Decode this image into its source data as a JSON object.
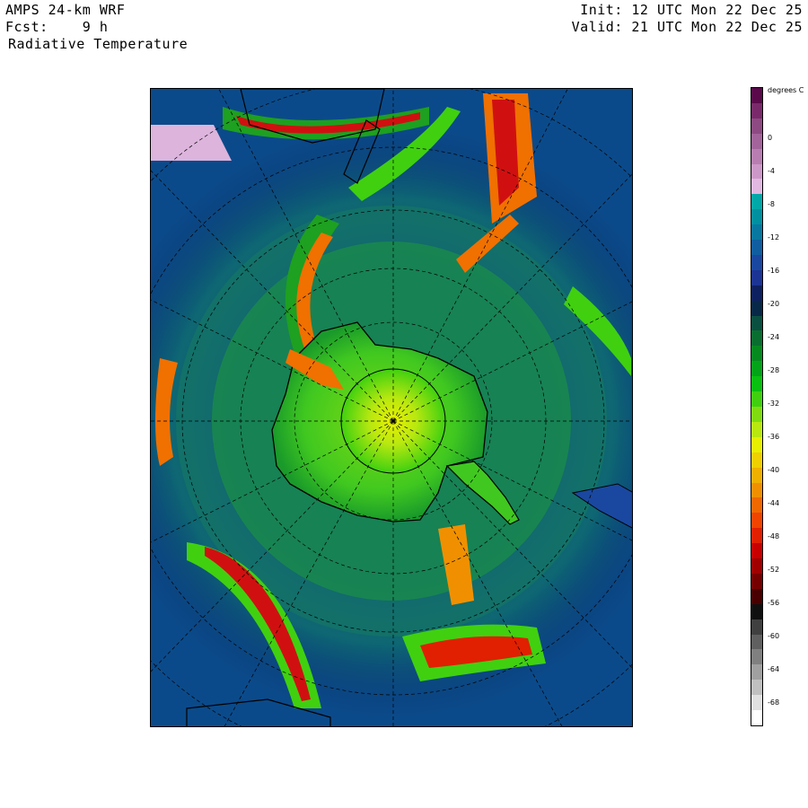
{
  "header": {
    "model": "AMPS 24-km WRF",
    "forecast": "Fcst:    9 h",
    "field": "Radiative Temperature",
    "init": "Init: 12 UTC Mon 22 Dec 25",
    "valid": "Valid: 21 UTC Mon 22 Dec 25"
  },
  "colorbar": {
    "units": "degrees C",
    "ticks": [
      "0",
      "-4",
      "-8",
      "-12",
      "-16",
      "-20",
      "-24",
      "-28",
      "-32",
      "-36",
      "-40",
      "-44",
      "-48",
      "-52",
      "-56",
      "-60",
      "-64",
      "-68"
    ],
    "colors": [
      "#5a0a4a",
      "#7a2a6a",
      "#8e4a82",
      "#a2649a",
      "#b87eb2",
      "#cc98c8",
      "#e0b8e0",
      "#00a8a8",
      "#0090a0",
      "#0878a0",
      "#105ea0",
      "#1a48a0",
      "#1c3494",
      "#0e2060",
      "#082848",
      "#0a5040",
      "#0a6e30",
      "#068a20",
      "#04a418",
      "#0ac010",
      "#40d010",
      "#80dc10",
      "#b8e810",
      "#e8f000",
      "#f0d000",
      "#f0b000",
      "#f09000",
      "#f06800",
      "#f04400",
      "#e02000",
      "#c80000",
      "#a00000",
      "#760000",
      "#480000",
      "#101010",
      "#404040",
      "#606060",
      "#808080",
      "#a0a0a0",
      "#c0c0c0",
      "#e0e0e0",
      "#ffffff"
    ]
  },
  "map": {
    "projection": "polar-stereographic",
    "region": "Antarctica",
    "colors": {
      "ocean": "#0b4a8a",
      "deep": "#0a2a6a",
      "cold_teal": "#1a7a8a",
      "green": "#1ea020",
      "lime": "#a8e010",
      "yellow": "#e8f000",
      "orange": "#f07000",
      "red": "#d01010",
      "dark_red": "#700000",
      "pink": "#dcb4dc",
      "coast": "#000000",
      "grid": "#000000"
    }
  }
}
